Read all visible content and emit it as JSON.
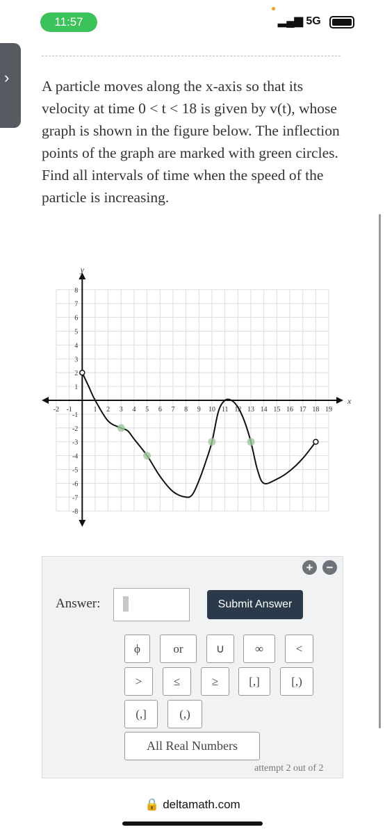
{
  "status_bar": {
    "time": "11:57",
    "network": "5G"
  },
  "side_tab": {
    "icon": "chevron-right-icon",
    "glyph": "›"
  },
  "question": {
    "text": "A particle moves along the x-axis so that its velocity at time 0 < t < 18 is given by v(t), whose graph is shown in the figure below. The inflection points of the graph are marked with green circles. Find all intervals of time when the speed of the particle is increasing."
  },
  "chart_data": {
    "type": "line",
    "xlabel": "x",
    "ylabel": "y",
    "xlim": [
      -2,
      19
    ],
    "ylim": [
      -8,
      8
    ],
    "x_ticks": [
      "-2",
      "-1",
      "1",
      "2",
      "3",
      "4",
      "5",
      "6",
      "7",
      "8",
      "9",
      "10",
      "11",
      "12",
      "13",
      "14",
      "15",
      "16",
      "17",
      "18",
      "19"
    ],
    "y_ticks": [
      "8",
      "7",
      "6",
      "5",
      "4",
      "3",
      "2",
      "1",
      "-1",
      "-2",
      "-3",
      "-4",
      "-5",
      "-6",
      "-7",
      "-8"
    ],
    "grid": true,
    "curve": [
      [
        0,
        2
      ],
      [
        0.5,
        1
      ],
      [
        1,
        0
      ],
      [
        2,
        -1.5
      ],
      [
        3,
        -2
      ],
      [
        3.5,
        -2.2
      ],
      [
        4,
        -2.8
      ],
      [
        5,
        -4
      ],
      [
        6,
        -5.5
      ],
      [
        7,
        -6.6
      ],
      [
        8,
        -7
      ],
      [
        8.5,
        -6.8
      ],
      [
        9,
        -5.8
      ],
      [
        9.5,
        -4.5
      ],
      [
        10,
        -3
      ],
      [
        10.5,
        -0.8
      ],
      [
        11,
        0
      ],
      [
        11.5,
        0
      ],
      [
        12,
        -0.5
      ],
      [
        12.5,
        -1.5
      ],
      [
        13,
        -3
      ],
      [
        13.5,
        -5
      ],
      [
        14,
        -6
      ],
      [
        15,
        -5.7
      ],
      [
        16,
        -5.1
      ],
      [
        17,
        -4.2
      ],
      [
        18,
        -3
      ]
    ],
    "open_endpoints": [
      [
        0,
        2
      ],
      [
        18,
        -3
      ]
    ],
    "inflection_points": [
      [
        3,
        -2
      ],
      [
        5,
        -4
      ],
      [
        10,
        -3
      ],
      [
        13,
        -3
      ]
    ],
    "colors": {
      "curve": "#111111",
      "inflection": "#9cc79a",
      "grid": "#dddddd"
    }
  },
  "answer": {
    "label": "Answer:",
    "value": "",
    "submit": "Submit Answer",
    "keys": [
      "ϕ",
      "or",
      "∪",
      "∞",
      "<",
      ">",
      "≤",
      "≥",
      "[,]",
      "[,)",
      "(,]",
      "(,)",
      "All Real Numbers"
    ],
    "attempt": "attempt 2 out of 2"
  },
  "footer": {
    "url": "deltamath.com"
  }
}
